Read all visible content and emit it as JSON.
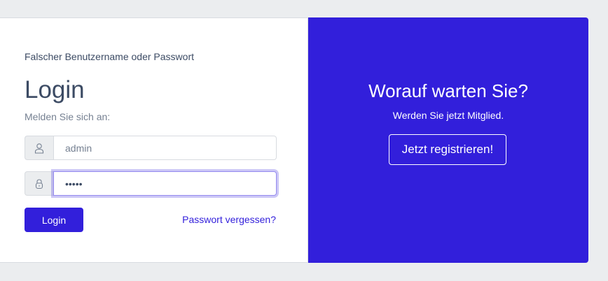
{
  "login": {
    "error": "Falscher Benutzername oder Passwort",
    "title": "Login",
    "subtitle": "Melden Sie sich an:",
    "username": {
      "value": "admin",
      "icon": "user-icon"
    },
    "password": {
      "value": "•••••",
      "icon": "lock-icon"
    },
    "login_label": "Login",
    "forgot_label": "Passwort vergessen?"
  },
  "register": {
    "title": "Worauf warten Sie?",
    "subtitle": "Werden Sie jetzt Mitglied.",
    "button_label": "Jetzt registrieren!"
  },
  "colors": {
    "primary": "#321fdb",
    "background": "#ebedef",
    "text": "#3c4b64",
    "muted": "#768192"
  }
}
